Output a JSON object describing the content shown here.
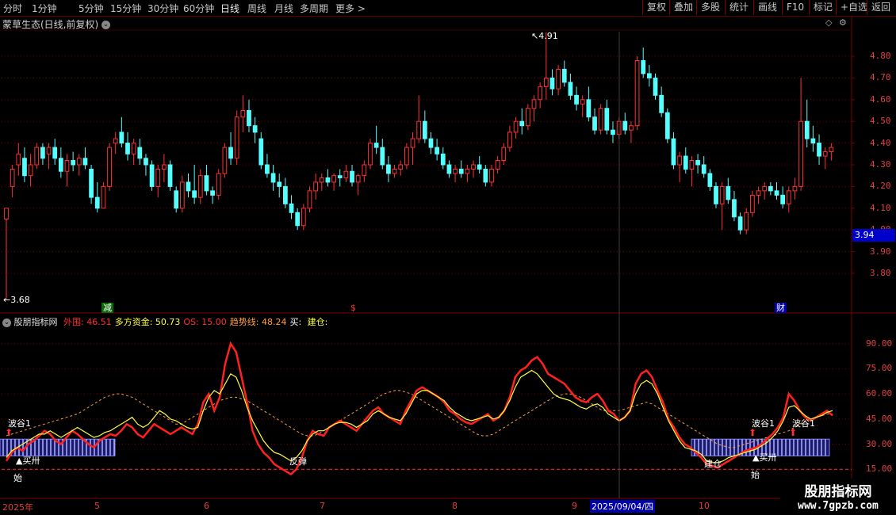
{
  "toolbar": {
    "periods": [
      "分时",
      "1分钟",
      "5分钟",
      "15分钟",
      "30分钟",
      "60分钟",
      "日线",
      "周线",
      "月线",
      "多周期",
      "更多 >"
    ],
    "active_period": "日线",
    "right_buttons": [
      "复权",
      "叠加",
      "多股",
      "统计",
      "画线",
      "F10",
      "标记",
      "+自选",
      "返回"
    ]
  },
  "chart_title": "蒙草生态(日线,前复权)",
  "price_axis": [
    "4.80",
    "4.70",
    "4.60",
    "4.50",
    "4.40",
    "4.30",
    "4.20",
    "4.10",
    "4.00",
    "3.90",
    "3.80"
  ],
  "current_price": "3.94",
  "high_annotation": "4.91",
  "low_annotation": "3.68",
  "event_markers": {
    "reduce": "减",
    "dollar": "$",
    "finance": "财"
  },
  "indicator": {
    "name": "股朋指标网",
    "items": [
      {
        "label": "外围:",
        "value": "46.51",
        "color": "#ff3030"
      },
      {
        "label": "多方资金:",
        "value": "50.73",
        "color": "#ffff40"
      },
      {
        "label": "OS:",
        "value": "15.00",
        "color": "#ff3030"
      },
      {
        "label": "趋势线:",
        "value": "48.24",
        "color": "#ff9f40"
      },
      {
        "label": "买:",
        "value": "",
        "color": "#ffffff"
      },
      {
        "label": "建仓:",
        "value": "",
        "color": "#ffff40"
      }
    ],
    "axis": [
      "90.00",
      "75.00",
      "60.00",
      "45.00",
      "30.00",
      "15.00"
    ]
  },
  "signals": {
    "wave_valley": "波谷1",
    "buy": "买卅",
    "start": "始",
    "rebound": "反弹",
    "build": "建仓"
  },
  "date_axis": {
    "labels": [
      "2025年",
      "5",
      "6",
      "7",
      "8",
      "9",
      "10"
    ],
    "highlight": "2025/09/04/四"
  },
  "watermark": {
    "line1": "股朋指标网",
    "line2": "www.7gpzb.com"
  },
  "colors": {
    "up": "#ff3232",
    "down": "#54ffff",
    "grid": "#7a0000",
    "ma_yellow": "#ffff40",
    "trend": "#ff9f40"
  },
  "chart_data": {
    "type": "candlestick",
    "ohlc": [
      [
        4.05,
        4.1,
        3.68,
        4.1
      ],
      [
        4.2,
        4.3,
        4.15,
        4.28
      ],
      [
        4.3,
        4.4,
        4.25,
        4.35
      ],
      [
        4.33,
        4.38,
        4.22,
        4.25
      ],
      [
        4.25,
        4.35,
        4.2,
        4.3
      ],
      [
        4.3,
        4.4,
        4.28,
        4.38
      ],
      [
        4.38,
        4.4,
        4.3,
        4.33
      ],
      [
        4.35,
        4.4,
        4.28,
        4.38
      ],
      [
        4.38,
        4.42,
        4.3,
        4.33
      ],
      [
        4.33,
        4.38,
        4.24,
        4.27
      ],
      [
        4.27,
        4.35,
        4.2,
        4.32
      ],
      [
        4.32,
        4.36,
        4.27,
        4.3
      ],
      [
        4.3,
        4.35,
        4.25,
        4.33
      ],
      [
        4.33,
        4.38,
        4.28,
        4.3
      ],
      [
        4.28,
        4.3,
        4.12,
        4.15
      ],
      [
        4.15,
        4.22,
        4.08,
        4.1
      ],
      [
        4.1,
        4.22,
        4.1,
        4.2
      ],
      [
        4.2,
        4.4,
        4.18,
        4.38
      ],
      [
        4.4,
        4.45,
        4.35,
        4.42
      ],
      [
        4.45,
        4.52,
        4.38,
        4.4
      ],
      [
        4.4,
        4.45,
        4.32,
        4.35
      ],
      [
        4.35,
        4.42,
        4.3,
        4.4
      ],
      [
        4.38,
        4.42,
        4.3,
        4.33
      ],
      [
        4.33,
        4.35,
        4.25,
        4.3
      ],
      [
        4.3,
        4.32,
        4.18,
        4.2
      ],
      [
        4.2,
        4.3,
        4.15,
        4.28
      ],
      [
        4.28,
        4.35,
        4.22,
        4.3
      ],
      [
        4.3,
        4.32,
        4.18,
        4.2
      ],
      [
        4.18,
        4.2,
        4.08,
        4.1
      ],
      [
        4.1,
        4.25,
        4.08,
        4.22
      ],
      [
        4.22,
        4.26,
        4.15,
        4.18
      ],
      [
        4.18,
        4.3,
        4.12,
        4.15
      ],
      [
        4.15,
        4.28,
        4.12,
        4.25
      ],
      [
        4.25,
        4.3,
        4.16,
        4.18
      ],
      [
        4.18,
        4.2,
        4.12,
        4.16
      ],
      [
        4.16,
        4.28,
        4.14,
        4.26
      ],
      [
        4.26,
        4.4,
        4.24,
        4.38
      ],
      [
        4.38,
        4.45,
        4.3,
        4.33
      ],
      [
        4.33,
        4.55,
        4.3,
        4.52
      ],
      [
        4.52,
        4.62,
        4.45,
        4.55
      ],
      [
        4.55,
        4.6,
        4.45,
        4.48
      ],
      [
        4.48,
        4.52,
        4.4,
        4.45
      ],
      [
        4.42,
        4.45,
        4.28,
        4.3
      ],
      [
        4.3,
        4.35,
        4.24,
        4.26
      ],
      [
        4.26,
        4.3,
        4.18,
        4.22
      ],
      [
        4.22,
        4.26,
        4.15,
        4.2
      ],
      [
        4.2,
        4.24,
        4.1,
        4.12
      ],
      [
        4.12,
        4.16,
        4.05,
        4.08
      ],
      [
        4.08,
        4.1,
        4.0,
        4.02
      ],
      [
        4.02,
        4.12,
        4.0,
        4.1
      ],
      [
        4.1,
        4.2,
        4.08,
        4.18
      ],
      [
        4.18,
        4.26,
        4.14,
        4.22
      ],
      [
        4.22,
        4.26,
        4.18,
        4.24
      ],
      [
        4.24,
        4.28,
        4.2,
        4.22
      ],
      [
        4.22,
        4.26,
        4.18,
        4.25
      ],
      [
        4.25,
        4.28,
        4.2,
        4.24
      ],
      [
        4.24,
        4.3,
        4.22,
        4.27
      ],
      [
        4.27,
        4.3,
        4.2,
        4.22
      ],
      [
        4.22,
        4.26,
        4.16,
        4.25
      ],
      [
        4.25,
        4.32,
        4.22,
        4.3
      ],
      [
        4.3,
        4.42,
        4.28,
        4.4
      ],
      [
        4.4,
        4.48,
        4.35,
        4.38
      ],
      [
        4.38,
        4.42,
        4.28,
        4.3
      ],
      [
        4.3,
        4.34,
        4.22,
        4.26
      ],
      [
        4.26,
        4.3,
        4.24,
        4.28
      ],
      [
        4.28,
        4.32,
        4.25,
        4.3
      ],
      [
        4.3,
        4.4,
        4.28,
        4.38
      ],
      [
        4.38,
        4.45,
        4.3,
        4.42
      ],
      [
        4.42,
        4.62,
        4.4,
        4.5
      ],
      [
        4.5,
        4.55,
        4.4,
        4.42
      ],
      [
        4.42,
        4.45,
        4.35,
        4.38
      ],
      [
        4.38,
        4.42,
        4.32,
        4.35
      ],
      [
        4.35,
        4.38,
        4.28,
        4.3
      ],
      [
        4.3,
        4.32,
        4.24,
        4.26
      ],
      [
        4.26,
        4.3,
        4.22,
        4.28
      ],
      [
        4.28,
        4.32,
        4.24,
        4.26
      ],
      [
        4.26,
        4.3,
        4.22,
        4.28
      ],
      [
        4.28,
        4.32,
        4.24,
        4.3
      ],
      [
        4.3,
        4.34,
        4.26,
        4.28
      ],
      [
        4.28,
        4.3,
        4.2,
        4.22
      ],
      [
        4.22,
        4.3,
        4.2,
        4.28
      ],
      [
        4.28,
        4.34,
        4.26,
        4.32
      ],
      [
        4.32,
        4.4,
        4.3,
        4.38
      ],
      [
        4.38,
        4.48,
        4.36,
        4.45
      ],
      [
        4.45,
        4.52,
        4.42,
        4.5
      ],
      [
        4.5,
        4.56,
        4.44,
        4.48
      ],
      [
        4.48,
        4.58,
        4.46,
        4.56
      ],
      [
        4.56,
        4.62,
        4.5,
        4.6
      ],
      [
        4.6,
        4.68,
        4.56,
        4.66
      ],
      [
        4.66,
        4.91,
        4.6,
        4.7
      ],
      [
        4.7,
        4.74,
        4.62,
        4.65
      ],
      [
        4.65,
        4.76,
        4.62,
        4.74
      ],
      [
        4.74,
        4.78,
        4.66,
        4.68
      ],
      [
        4.68,
        4.72,
        4.6,
        4.62
      ],
      [
        4.62,
        4.66,
        4.55,
        4.58
      ],
      [
        4.58,
        4.62,
        4.52,
        4.6
      ],
      [
        4.6,
        4.66,
        4.5,
        4.52
      ],
      [
        4.52,
        4.56,
        4.44,
        4.46
      ],
      [
        4.46,
        4.58,
        4.44,
        4.56
      ],
      [
        4.56,
        4.6,
        4.44,
        4.46
      ],
      [
        4.46,
        4.5,
        4.4,
        4.44
      ],
      [
        4.44,
        4.52,
        4.42,
        4.5
      ],
      [
        4.5,
        4.54,
        4.44,
        4.46
      ],
      [
        4.46,
        4.5,
        4.4,
        4.48
      ],
      [
        4.48,
        4.8,
        4.46,
        4.78
      ],
      [
        4.78,
        4.84,
        4.7,
        4.72
      ],
      [
        4.72,
        4.76,
        4.66,
        4.7
      ],
      [
        4.7,
        4.72,
        4.6,
        4.62
      ],
      [
        4.62,
        4.66,
        4.52,
        4.54
      ],
      [
        4.54,
        4.56,
        4.4,
        4.42
      ],
      [
        4.42,
        4.45,
        4.28,
        4.3
      ],
      [
        4.3,
        4.36,
        4.22,
        4.34
      ],
      [
        4.34,
        4.38,
        4.26,
        4.28
      ],
      [
        4.28,
        4.34,
        4.2,
        4.32
      ],
      [
        4.32,
        4.35,
        4.26,
        4.3
      ],
      [
        4.3,
        4.34,
        4.24,
        4.26
      ],
      [
        4.26,
        4.28,
        4.18,
        4.2
      ],
      [
        4.2,
        4.22,
        4.1,
        4.12
      ],
      [
        4.12,
        4.22,
        4.0,
        4.2
      ],
      [
        4.2,
        4.24,
        4.12,
        4.14
      ],
      [
        4.14,
        4.18,
        4.04,
        4.06
      ],
      [
        4.06,
        4.08,
        3.98,
        4.0
      ],
      [
        4.0,
        4.1,
        3.98,
        4.08
      ],
      [
        4.08,
        4.18,
        4.06,
        4.16
      ],
      [
        4.16,
        4.2,
        4.12,
        4.18
      ],
      [
        4.18,
        4.22,
        4.14,
        4.2
      ],
      [
        4.2,
        4.22,
        4.16,
        4.18
      ],
      [
        4.18,
        4.22,
        4.14,
        4.16
      ],
      [
        4.16,
        4.2,
        4.1,
        4.12
      ],
      [
        4.12,
        4.2,
        4.08,
        4.18
      ],
      [
        4.18,
        4.24,
        4.14,
        4.2
      ],
      [
        4.2,
        4.7,
        4.18,
        4.5
      ],
      [
        4.5,
        4.6,
        4.38,
        4.42
      ],
      [
        4.42,
        4.48,
        4.36,
        4.4
      ],
      [
        4.4,
        4.44,
        4.3,
        4.34
      ],
      [
        4.34,
        4.38,
        4.28,
        4.36
      ],
      [
        4.36,
        4.4,
        4.32,
        4.38
      ]
    ],
    "price_range": [
      3.68,
      4.91
    ],
    "indicator_series": {
      "外围": [
        20,
        25,
        28,
        26,
        30,
        32,
        35,
        38,
        36,
        32,
        30,
        34,
        38,
        36,
        33,
        30,
        28,
        32,
        34,
        36,
        35,
        38,
        42,
        40,
        36,
        34,
        38,
        42,
        40,
        38,
        36,
        38,
        40,
        38,
        36,
        42,
        55,
        60,
        50,
        58,
        78,
        90,
        85,
        70,
        55,
        38,
        30,
        25,
        22,
        18,
        16,
        14,
        12,
        15,
        22,
        32,
        38,
        36,
        35,
        40,
        42,
        44,
        42,
        40,
        38,
        42,
        46,
        50,
        52,
        48,
        46,
        44,
        42,
        50,
        56,
        62,
        64,
        62,
        60,
        58,
        55,
        50,
        48,
        45,
        43,
        42,
        44,
        46,
        48,
        44,
        46,
        50,
        58,
        70,
        74,
        76,
        80,
        82,
        78,
        72,
        70,
        68,
        66,
        62,
        58,
        56,
        55,
        58,
        60,
        56,
        50,
        48,
        44,
        46,
        50,
        66,
        72,
        74,
        70,
        62,
        55,
        45,
        40,
        34,
        30,
        28,
        25,
        22,
        18,
        17,
        16,
        18,
        20,
        22,
        24,
        26,
        27,
        28,
        30,
        33,
        36,
        40,
        46,
        60,
        56,
        50,
        46,
        44,
        46,
        48,
        50,
        47
      ],
      "多方资金": [
        22,
        26,
        28,
        30,
        32,
        34,
        36,
        36,
        38,
        36,
        34,
        36,
        38,
        40,
        38,
        36,
        34,
        35,
        37,
        38,
        40,
        42,
        44,
        46,
        42,
        40,
        42,
        46,
        50,
        48,
        45,
        44,
        42,
        40,
        39,
        40,
        50,
        58,
        62,
        60,
        66,
        72,
        70,
        62,
        52,
        44,
        38,
        32,
        28,
        25,
        24,
        22,
        20,
        22,
        26,
        32,
        36,
        38,
        38,
        40,
        42,
        43,
        43,
        42,
        40,
        42,
        44,
        48,
        50,
        48,
        46,
        45,
        44,
        48,
        54,
        60,
        62,
        62,
        60,
        58,
        56,
        52,
        49,
        47,
        45,
        44,
        45,
        46,
        47,
        45,
        46,
        50,
        56,
        64,
        70,
        72,
        74,
        72,
        68,
        64,
        60,
        58,
        57,
        56,
        54,
        52,
        51,
        53,
        54,
        52,
        48,
        46,
        44,
        46,
        50,
        60,
        66,
        68,
        66,
        60,
        52,
        44,
        38,
        32,
        28,
        27,
        26,
        24,
        20,
        19,
        19,
        20,
        22,
        23,
        24,
        25,
        26,
        27,
        29,
        31,
        34,
        38,
        44,
        52,
        53,
        50,
        47,
        45,
        46,
        47,
        49,
        50
      ],
      "趋势线": [
        35,
        36,
        37,
        38,
        39,
        40,
        41,
        42,
        43,
        44,
        45,
        46,
        47,
        48,
        50,
        52,
        54,
        56,
        58,
        59,
        60,
        60,
        59,
        58,
        56,
        54,
        52,
        50,
        48,
        46,
        44,
        42,
        42,
        44,
        46,
        48,
        50,
        52,
        54,
        56,
        57,
        58,
        58,
        57,
        56,
        54,
        52,
        50,
        48,
        46,
        44,
        42,
        40,
        38,
        36,
        35,
        35,
        36,
        38,
        40,
        42,
        44,
        46,
        48,
        50,
        52,
        54,
        56,
        58,
        60,
        61,
        62,
        62,
        61,
        60,
        58,
        56,
        54,
        52,
        50,
        48,
        46,
        44,
        42,
        40,
        38,
        36,
        35,
        35,
        36,
        38,
        40,
        42,
        44,
        46,
        48,
        50,
        52,
        54,
        56,
        58,
        59,
        60,
        60,
        59,
        58,
        56,
        54,
        52,
        50,
        50,
        50,
        50,
        51,
        52,
        53,
        54,
        55,
        54,
        52,
        50,
        48,
        46,
        44,
        42,
        40,
        38,
        36,
        34,
        32,
        30,
        29,
        28,
        28,
        29,
        30,
        31,
        32,
        33,
        34,
        35,
        36,
        37,
        38,
        40,
        42,
        44,
        45,
        46,
        47,
        48,
        48
      ]
    },
    "indicator_range": [
      0,
      100
    ],
    "lines": {
      "OS": 15.0
    }
  }
}
